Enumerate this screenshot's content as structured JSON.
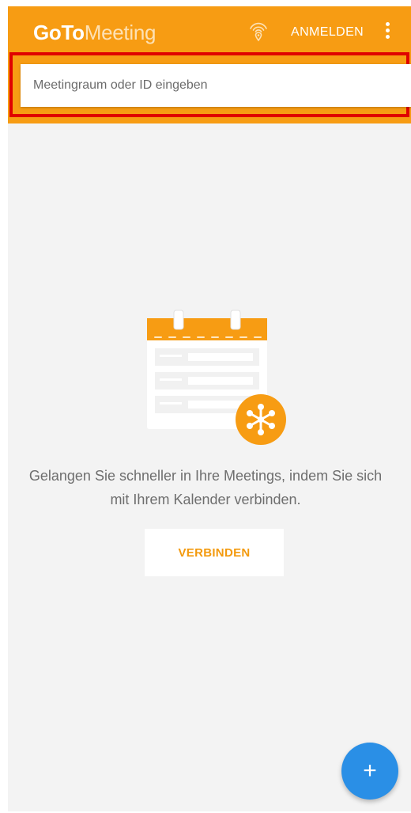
{
  "appbar": {
    "logo_bold": "GoTo",
    "logo_light": "Meeting",
    "signin_label": "ANMELDEN",
    "icons": {
      "broadcast": "wifi-signal-icon",
      "more": "more-vert-icon"
    }
  },
  "search": {
    "placeholder": "Meetingraum oder ID eingeben",
    "value": ""
  },
  "empty_state": {
    "illustration": "calendar-icon",
    "badge_icon": "meeting-node-icon",
    "message_line1": "Gelangen Sie schneller in Ihre Meetings, indem Sie sich",
    "message_line2": "mit Ihrem Kalender verbinden.",
    "connect_label": "VERBINDEN"
  },
  "fab": {
    "icon": "plus-icon",
    "label": "+"
  },
  "colors": {
    "brand_orange": "#f79c13",
    "fab_blue": "#2a8fe6",
    "highlight_red": "#e00000"
  }
}
